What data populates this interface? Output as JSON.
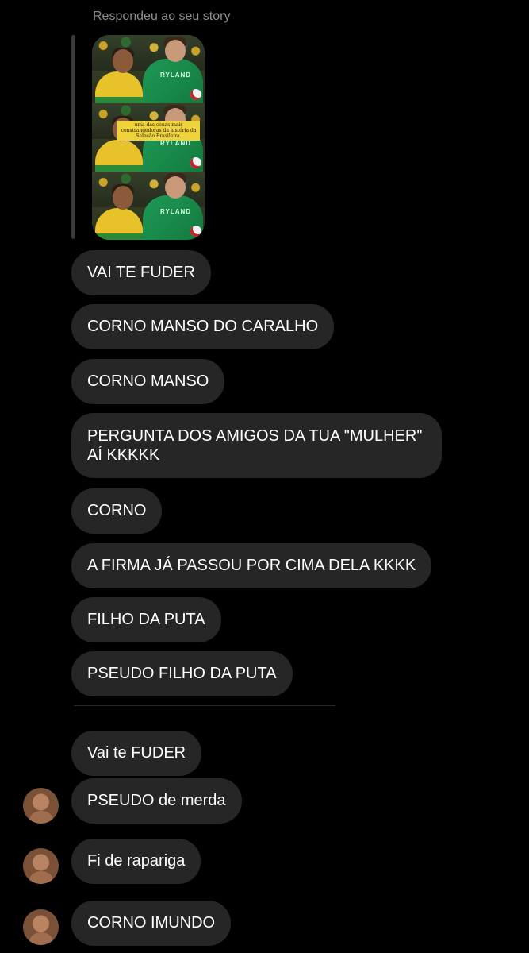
{
  "reply": {
    "header": "Respondeu ao seu story",
    "story_caption": "uma das cenas mais constrangedoras da história da Seleção Brasileira.",
    "jersey_name": "RYLAND"
  },
  "messages": [
    {
      "text": "VAI TE FUDER"
    },
    {
      "text": "CORNO MANSO DO CARALHO"
    },
    {
      "text": "CORNO MANSO"
    },
    {
      "text": "PERGUNTA DOS AMIGOS DA TUA \"MULHER\" AÍ KKKKK"
    },
    {
      "text": "CORNO"
    },
    {
      "text": "A FIRMA JÁ PASSOU POR CIMA DELA KKKK"
    },
    {
      "text": "FILHO DA PUTA"
    },
    {
      "text": "PSEUDO FILHO DA PUTA"
    },
    {
      "text": "Vai te FUDER"
    },
    {
      "text": "PSEUDO de merda"
    },
    {
      "text": "Fi de rapariga"
    },
    {
      "text": "CORNO IMUNDO"
    }
  ],
  "colors": {
    "background": "#000000",
    "bubble": "#262626",
    "text": "#ffffff",
    "muted": "#8e8e8e"
  }
}
